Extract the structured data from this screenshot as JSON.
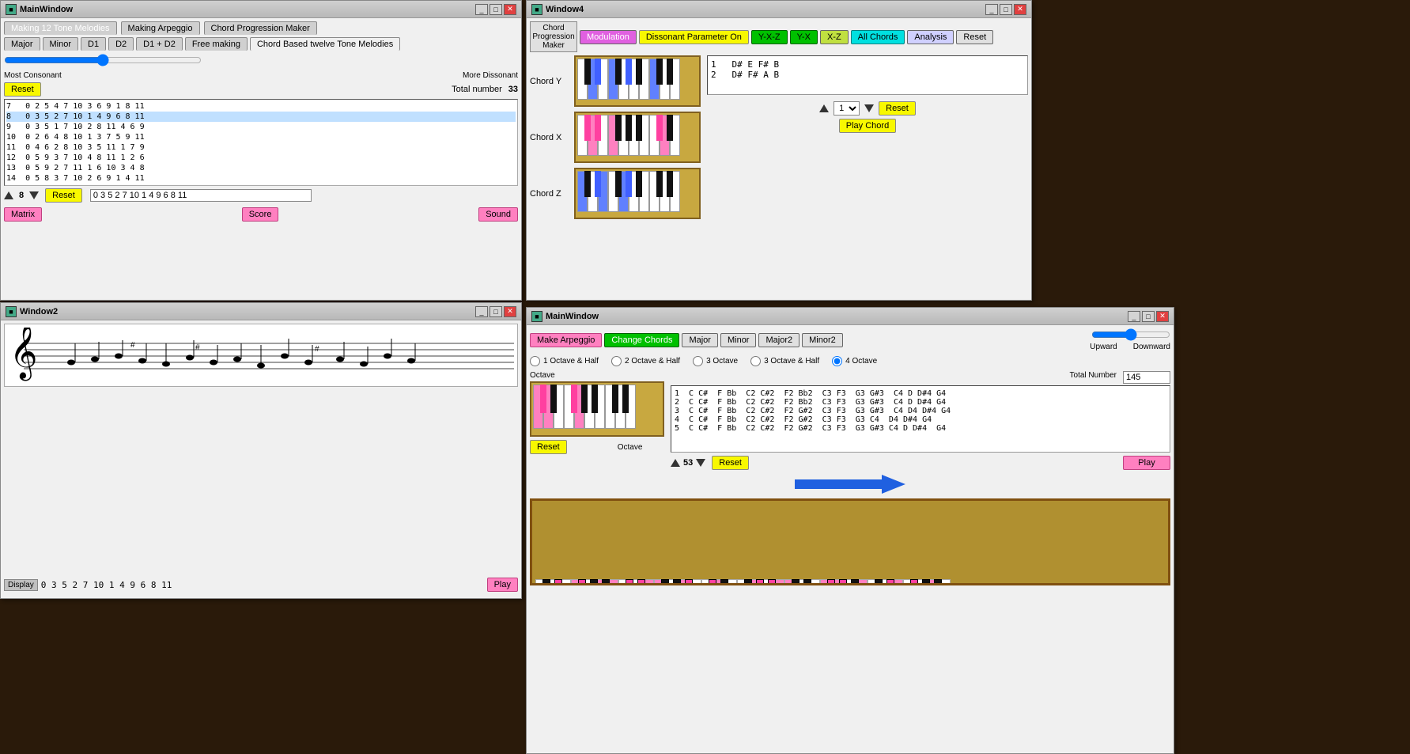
{
  "win_main1": {
    "title": "MainWindow",
    "tabs_top": [
      "Making 12 Tone Melodies",
      "Making Arpeggio",
      "Chord Progression Maker"
    ],
    "tabs_sub": [
      "Major",
      "Minor",
      "D1",
      "D2",
      "D1 + D2",
      "Free making",
      "Chord Based twelve Tone Melodies"
    ],
    "slider_label_left": "Most Consonant",
    "slider_label_right": "More Dissonant",
    "total_number_label": "Total number",
    "total_number_value": "33",
    "reset_btn": "Reset",
    "rows": [
      {
        "num": "7",
        "vals": "0 2 5 4 7 10 3 6 9 1 8 11"
      },
      {
        "num": "8",
        "vals": "0 3 5 2 7 10 1 4 9 6 8 11"
      },
      {
        "num": "9",
        "vals": "0 3 5 1 7 10 2 8 11 4 6 9"
      },
      {
        "num": "10",
        "vals": "0 2 6 4 8 10 1 3 7 5 9 11"
      },
      {
        "num": "11",
        "vals": "0 4 6 2 8 10 3 5 11 1 7 9"
      },
      {
        "num": "12",
        "vals": "0 5 9 3 7 10 4 8 11 1 2 6"
      },
      {
        "num": "13",
        "vals": "0 5 9 2 7 11 1 6 10 3 4 8"
      },
      {
        "num": "14",
        "vals": "0 5 8 3 7 10 2 6 9 1 4 11"
      }
    ],
    "selected_row": "8",
    "sequence_display": "0 3 5 2 7 10 1 4 9 6 8 11",
    "matrix_btn": "Matrix",
    "score_btn": "Score",
    "sound_btn": "Sound"
  },
  "win_window2": {
    "title": "Window2",
    "display_label": "Display",
    "display_value": "0 3 5 2 7 10 1 4 9 6 8 11",
    "play_btn": "Play"
  },
  "win_chord_prog": {
    "title": "Window4",
    "btn_modulation": "Modulation",
    "btn_dissonant": "Dissonant Parameter On",
    "btn_yxz": "Y-X-Z",
    "btn_yx": "Y-X",
    "btn_xz": "X-Z",
    "btn_all_chords": "All Chords",
    "btn_analysis": "Analysis",
    "btn_reset": "Reset",
    "chord_y_label": "Chord Y",
    "chord_x_label": "Chord X",
    "chord_z_label": "Chord Z",
    "chord_list": [
      {
        "num": "1",
        "notes": "D# E F# B"
      },
      {
        "num": "2",
        "notes": "D# F# A B"
      }
    ],
    "spinner_value": "1",
    "reset_btn2": "Reset",
    "play_chord_btn": "Play Chord"
  },
  "win_main_window": {
    "title": "MainWindow",
    "btn_make_arpeggio": "Make Arpeggio",
    "btn_change_chords": "Change Chords",
    "btn_major": "Major",
    "btn_minor": "Minor",
    "btn_major2": "Major2",
    "btn_minor2": "Minor2",
    "range_labels": [
      "1 Octave & Half",
      "2 Octave & Half",
      "3 Octave",
      "3 Octave & Half",
      "4 Octave"
    ],
    "range_selected": 4,
    "upward_label": "Upward",
    "downward_label": "Downward",
    "octave_label": "Octave",
    "octave_label2": "Octave",
    "reset_btn": "Reset",
    "total_number_label": "Total Number",
    "total_number_value": "145",
    "chord_rows": [
      {
        "num": "1",
        "notes": "C C#  F Bb  C2 C#2  F2 Bb2  C3 F3  G3 G#3  C4 D D#4 G4"
      },
      {
        "num": "2",
        "notes": "C C#  F Bb  C2 C#2  F2 Bb2  C3 F3  G3 G#3  C4 D D#4 G4"
      },
      {
        "num": "3",
        "notes": "C C#  F Bb  C2 C#2  F2 G#2  C3 F3  G3 G#3  C4 D4 D#4 G4"
      },
      {
        "num": "4",
        "notes": "C C#  F Bb  C2 C#2  F2 G#2  C3 F3  G3 C4  D4 D#4 G4"
      },
      {
        "num": "5",
        "notes": "C C#  F Bb  C2 C#2  F2 G#2  C3 F3  G3 G#3 C4 D D#4  G4"
      }
    ],
    "spinner_value": "53",
    "play_btn": "Play"
  }
}
